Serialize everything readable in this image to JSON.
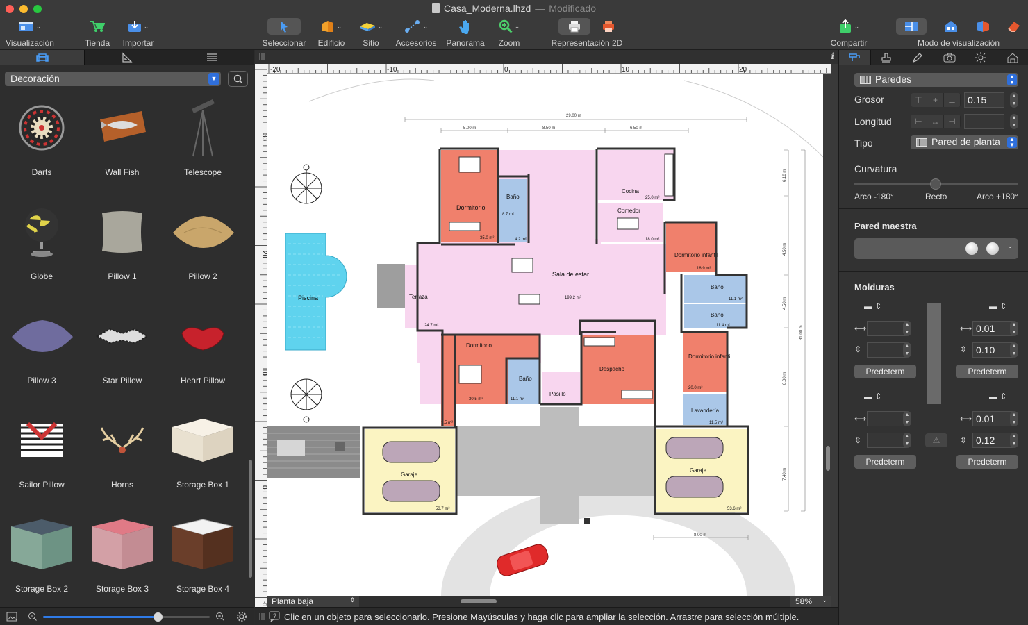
{
  "window": {
    "title": "Casa_Moderna.lhzd",
    "separator": "—",
    "status": "Modificado"
  },
  "toolbar": {
    "visualizacion": "Visualización",
    "tienda": "Tienda",
    "importar": "Importar",
    "seleccionar": "Seleccionar",
    "edificio": "Edificio",
    "sitio": "Sitio",
    "accesorios": "Accesorios",
    "panorama": "Panorama",
    "zoom": "Zoom",
    "representacion": "Representación 2D",
    "compartir": "Compartir",
    "modo": "Modo de visualización"
  },
  "library": {
    "category": "Decoración",
    "items": [
      {
        "name": "Darts"
      },
      {
        "name": "Wall Fish"
      },
      {
        "name": "Telescope"
      },
      {
        "name": "Globe"
      },
      {
        "name": "Pillow 1"
      },
      {
        "name": "Pillow 2"
      },
      {
        "name": "Pillow 3"
      },
      {
        "name": "Star Pillow"
      },
      {
        "name": "Heart Pillow"
      },
      {
        "name": "Sailor Pillow"
      },
      {
        "name": "Horns"
      },
      {
        "name": "Storage Box 1"
      },
      {
        "name": "Storage Box 2"
      },
      {
        "name": "Storage Box 3"
      },
      {
        "name": "Storage Box 4"
      }
    ],
    "zoom_level": 0.69
  },
  "rulers": {
    "h": [
      "-20",
      "-10",
      "0",
      "10",
      "20"
    ],
    "v": [
      "30",
      "20",
      "10",
      "0",
      "-10"
    ]
  },
  "plan": {
    "rooms": {
      "dormitorio1": "Dormitorio",
      "dormitorio1_area": "35.0 m²",
      "bano1": "Baño",
      "bano1_area": "8.7 m²",
      "bano1_area2": "4.2 m²",
      "cocina": "Cocina",
      "cocina_area": "25.0 m²",
      "comedor": "Comedor",
      "comedor_area": "18.0 m²",
      "infantil1": "Dormitorio infantil",
      "infantil1_area": "18.9 m²",
      "terraza": "Terraza",
      "terraza_area": "24.7 m²",
      "sala": "Sala de estar",
      "sala_area": "199.2 m²",
      "bano2": "Baño",
      "bano2_area": "11.1 m²",
      "bano3": "Baño",
      "bano3_area": "11.4 m²",
      "dormitorio2": "Dormitorio",
      "dormitorio2_area": "30.5 m²",
      "bano4": "Baño",
      "bano4_area": "11.1 m²",
      "pasillo": "Pasillo",
      "despacho": "Despacho",
      "infantil2": "Dormitorio infantil",
      "infantil2_area": "20.0 m²",
      "lavanderia": "Lavandería",
      "lavanderia_area": "11.5 m²",
      "extra_area": "9.5 m²",
      "piscina": "Piscina",
      "garaje1": "Garaje",
      "garaje1_area": "53.7 m²",
      "garaje2": "Garaje",
      "garaje2_area": "53.6 m²"
    },
    "dims": {
      "total": "29.00 m",
      "a": "5.00 m",
      "b": "8.50 m",
      "c": "6.50 m",
      "v1": "6.10 m",
      "v2": "4.50 m",
      "v3": "4.50 m",
      "v4": "8.00 m",
      "v5": "7.40 m",
      "vtotal": "31.00 m",
      "bottom": "8.00 m"
    }
  },
  "canvas_footer": {
    "level": "Planta baja",
    "zoom": "58%"
  },
  "status_message": "Clic en un objeto para seleccionarlo. Presione Mayúsculas y haga clic para ampliar la selección. Arrastre para selección múltiple.",
  "inspector": {
    "type_popup": "Paredes",
    "grosor_label": "Grosor",
    "grosor_value": "0.15",
    "longitud_label": "Longitud",
    "tipo_label": "Tipo",
    "tipo_value": "Pared de planta",
    "curvatura_label": "Curvatura",
    "arc_min": "Arco -180°",
    "arc_mid": "Recto",
    "arc_max": "Arco +180°",
    "pared_maestra": "Pared maestra",
    "molduras": "Molduras",
    "top_right_w": "0.01",
    "top_right_h": "0.10",
    "bot_right_w": "0.01",
    "bot_right_h": "0.12",
    "predeterm": "Predeterm"
  }
}
